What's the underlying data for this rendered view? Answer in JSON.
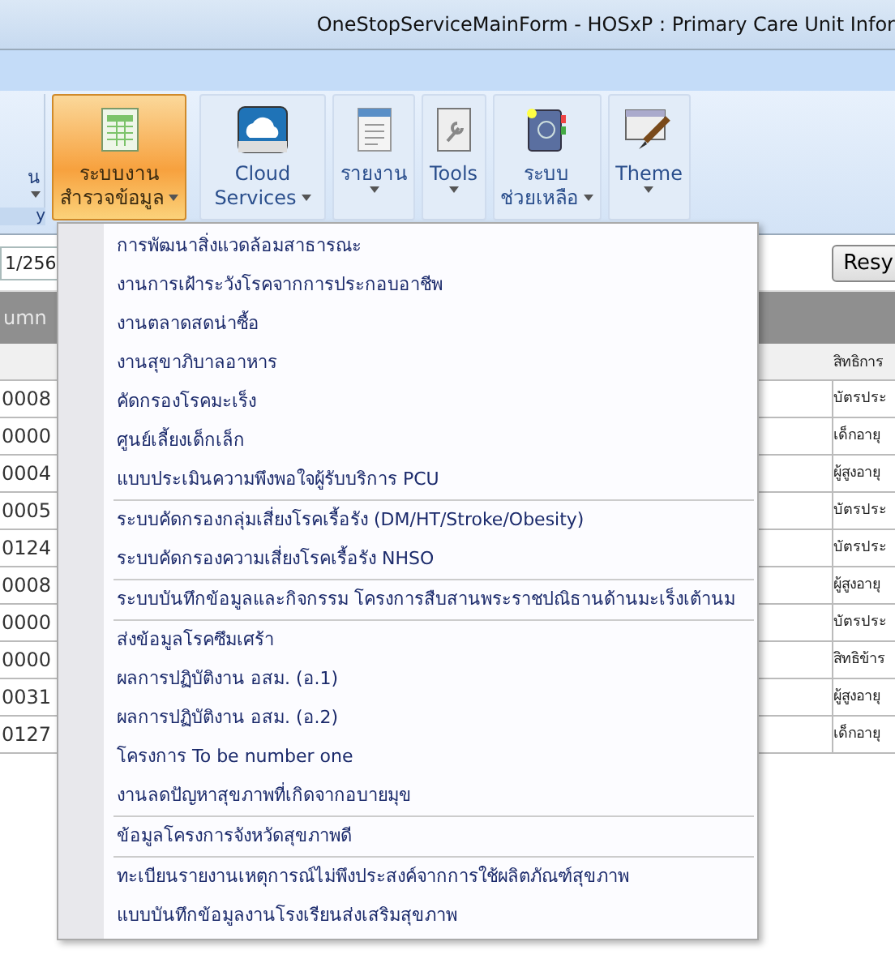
{
  "window": {
    "title": "OneStopServiceMainForm -  HOSxP : Primary Care Unit Infor"
  },
  "ribbon": {
    "partial_group": {
      "label": "น",
      "tab": "y",
      "dropdown": true
    },
    "buttons": [
      {
        "lines": [
          "ระบบงาน",
          "สำรวจข้อมูล"
        ],
        "selected": true,
        "dropdown": true
      },
      {
        "lines": [
          "Cloud",
          "Services"
        ],
        "selected": false,
        "dropdown": true
      },
      {
        "lines": [
          "รายงาน"
        ],
        "selected": false,
        "dropdown": true
      },
      {
        "lines": [
          "Tools"
        ],
        "selected": false,
        "dropdown": true
      },
      {
        "lines": [
          "ระบบ",
          "ช่วยเหลือ"
        ],
        "selected": false,
        "dropdown": true
      },
      {
        "lines": [
          "Theme"
        ],
        "selected": false,
        "dropdown": true
      }
    ]
  },
  "filter": {
    "date_value": "1/256",
    "button": "Resy"
  },
  "grid": {
    "group_panel": "umn",
    "column_header": "สิทธิการ",
    "rows": [
      {
        "column_1": "0008",
        "column_2": "บัตรประ"
      },
      {
        "column_1": "0000",
        "column_2": "เด็กอายุ"
      },
      {
        "column_1": "0004",
        "column_2": "ผู้สูงอายุ"
      },
      {
        "column_1": "0005",
        "column_2": "บัตรประ"
      },
      {
        "column_1": "0124",
        "column_2": "บัตรประ"
      },
      {
        "column_1": "0008",
        "column_2": "ผู้สูงอายุ"
      },
      {
        "column_1": "0000",
        "column_2": "บัตรประ"
      },
      {
        "column_1": "0000",
        "column_2": "สิทธิข้าร"
      },
      {
        "column_1": "0031",
        "column_2": "ผู้สูงอายุ"
      },
      {
        "column_1": "0127",
        "column_2": "เด็กอายุ"
      }
    ]
  },
  "menu": {
    "items": [
      {
        "label": "การพัฒนาสิ่งแวดล้อมสาธารณะ",
        "separator_before": false
      },
      {
        "label": "งานการเฝ้าระวังโรคจากการประกอบอาชีพ",
        "separator_before": false
      },
      {
        "label": "งานตลาดสดน่าซื้อ",
        "separator_before": false
      },
      {
        "label": "งานสุขาภิบาลอาหาร",
        "separator_before": false
      },
      {
        "label": "คัดกรองโรคมะเร็ง",
        "separator_before": false
      },
      {
        "label": "ศูนย์เลี้ยงเด็กเล็ก",
        "separator_before": false
      },
      {
        "label": "แบบประเมินความพึงพอใจผู้รับบริการ PCU",
        "separator_before": false
      },
      {
        "label": "ระบบคัดกรองกลุ่มเสี่ยงโรคเรื้อรัง (DM/HT/Stroke/Obesity)",
        "separator_before": true
      },
      {
        "label": "ระบบคัดกรองความเสี่ยงโรคเรื้อรัง NHSO",
        "separator_before": false
      },
      {
        "label": "ระบบบันทึกข้อมูลและกิจกรรม โครงการสืบสานพระราชปณิธานด้านมะเร็งเต้านม",
        "separator_before": true
      },
      {
        "label": "ส่งข้อมูลโรคซึมเศร้า",
        "separator_before": true
      },
      {
        "label": "ผลการปฏิบัติงาน อสม. (อ.1)",
        "separator_before": false
      },
      {
        "label": "ผลการปฏิบัติงาน อสม. (อ.2)",
        "separator_before": false
      },
      {
        "label": "โครงการ To be number one",
        "separator_before": false
      },
      {
        "label": "งานลดปัญหาสุขภาพที่เกิดจากอบายมุข",
        "separator_before": false
      },
      {
        "label": "ข้อมูลโครงการจังหวัดสุขภาพดี",
        "separator_before": true
      },
      {
        "label": "ทะเบียนรายงานเหตุการณ์ไม่พึงประสงค์จากการใช้ผลิตภัณฑ์สุขภาพ",
        "separator_before": true
      },
      {
        "label": "แบบบันทึกข้อมูลงานโรงเรียนส่งเสริมสุขภาพ",
        "separator_before": false
      }
    ]
  }
}
